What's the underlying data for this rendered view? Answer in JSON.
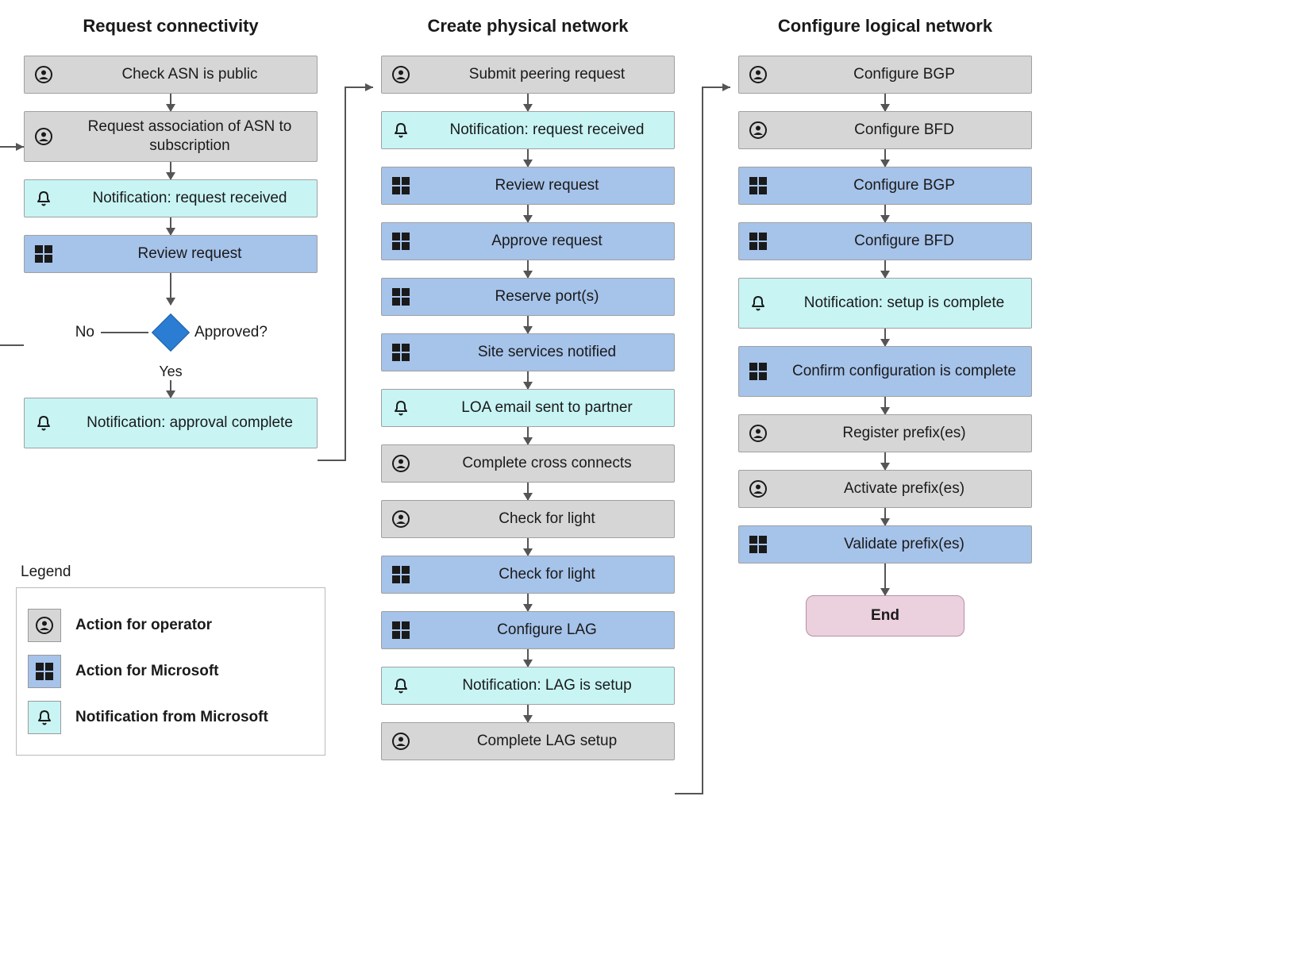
{
  "columns": {
    "c1": {
      "title": "Request connectivity",
      "steps": {
        "s1": "Check ASN is public",
        "s2": "Request association of ASN to subscription",
        "s3": "Notification: request received",
        "s4": "Review request",
        "s5": "Notification: approval complete"
      },
      "decision": {
        "question": "Approved?",
        "no": "No",
        "yes": "Yes"
      }
    },
    "c2": {
      "title": "Create physical network",
      "steps": {
        "s1": "Submit peering request",
        "s2": "Notification: request received",
        "s3": "Review request",
        "s4": "Approve request",
        "s5": "Reserve port(s)",
        "s6": "Site services notified",
        "s7": "LOA email sent to partner",
        "s8": "Complete cross connects",
        "s9": "Check for light",
        "s10": "Check for light",
        "s11": "Configure LAG",
        "s12": "Notification: LAG is setup",
        "s13": "Complete LAG setup"
      }
    },
    "c3": {
      "title": "Configure logical network",
      "steps": {
        "s1": "Configure BGP",
        "s2": "Configure BFD",
        "s3": "Configure BGP",
        "s4": "Configure BFD",
        "s5": "Notification: setup is complete",
        "s6": "Confirm configuration is complete",
        "s7": "Register prefix(es)",
        "s8": "Activate prefix(es)",
        "s9": "Validate prefix(es)"
      },
      "end": "End"
    }
  },
  "legend": {
    "title": "Legend",
    "operator": "Action for operator",
    "microsoft": "Action for Microsoft",
    "notification": "Notification from Microsoft"
  },
  "colors": {
    "operator": "#d6d6d6",
    "microsoft": "#a6c3ea",
    "notification": "#c8f4f4",
    "end": "#ebd0de",
    "diamond": "#2b7cd3"
  }
}
